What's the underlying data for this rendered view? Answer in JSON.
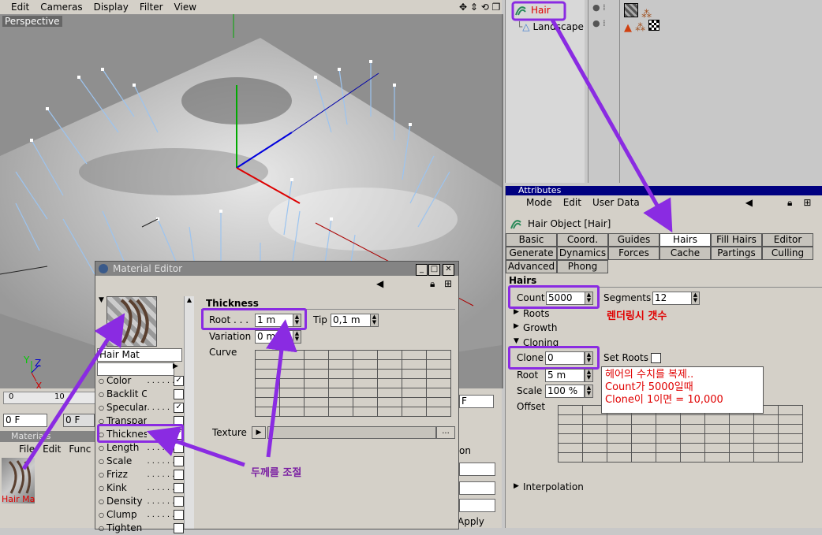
{
  "viewport_menu": {
    "edit": "Edit",
    "cameras": "Cameras",
    "display": "Display",
    "filter": "Filter",
    "view": "View"
  },
  "viewport": {
    "label": "Perspective"
  },
  "objects": [
    {
      "name": "Hair",
      "color": "#e00000"
    },
    {
      "name": "Landscape",
      "color": "#000000"
    }
  ],
  "attributes": {
    "title": "Attributes",
    "menu": {
      "mode": "Mode",
      "edit": "Edit",
      "user_data": "User Data"
    },
    "object_title": "Hair Object [Hair]",
    "tabs": [
      "Basic",
      "Coord.",
      "Guides",
      "Hairs",
      "Fill Hairs",
      "Editor",
      "Generate",
      "Dynamics",
      "Forces",
      "Cache",
      "Partings",
      "Culling",
      "Advanced",
      "Phong"
    ],
    "active_tab": "Hairs",
    "section": "Hairs",
    "count_label": "Count",
    "count_value": "5000",
    "segments_label": "Segments",
    "segments_value": "12",
    "roots_group": "Roots",
    "growth_group": "Growth",
    "cloning_group": "Cloning",
    "clone_label": "Clone",
    "clone_value": "0",
    "set_roots_label": "Set Roots",
    "root_label": "Root",
    "root_value": "5 m",
    "scale_label": "Scale",
    "scale_value": "100 %",
    "offset_label": "Offset",
    "interpolation_group": "Interpolation"
  },
  "annotations": {
    "count_note": "렌더링시 갯수",
    "clone_note_1": "헤어의 수치를 복제..",
    "clone_note_2": "Count가 5000일때",
    "clone_note_3": "Clone이 1이면 = 10,000",
    "thickness_note": "두께를 조절"
  },
  "material_editor": {
    "title": "Material Editor",
    "material_name": "Hair Mat",
    "channels": [
      {
        "label": "Color",
        "dots": " . . . . . . . .",
        "checked": true
      },
      {
        "label": "Backlit Color",
        "dots": "",
        "checked": false
      },
      {
        "label": "Specular",
        "dots": " . . . . .",
        "checked": true
      },
      {
        "label": "Transparency",
        "dots": "",
        "checked": false
      },
      {
        "label": "Thickness",
        "dots": "",
        "checked": true
      },
      {
        "label": "Length",
        "dots": " . . . . . . .",
        "checked": false
      },
      {
        "label": "Scale",
        "dots": " . . . . . . . .",
        "checked": false
      },
      {
        "label": "Frizz",
        "dots": " . . . . . . . .",
        "checked": false
      },
      {
        "label": "Kink",
        "dots": " . . . . . . . .",
        "checked": false
      },
      {
        "label": "Density",
        "dots": " . . . . . .",
        "checked": false
      },
      {
        "label": "Clump",
        "dots": " . . . . . . .",
        "checked": false
      },
      {
        "label": "Tighten",
        "dots": "",
        "checked": false
      }
    ],
    "section": "Thickness",
    "root_label": "Root . . .",
    "root_value": "1 m",
    "tip_label": "Tip",
    "tip_value": "0,1 m",
    "variation_label": "Variation",
    "variation_value": "0 m",
    "curve_label": "Curve",
    "texture_label": "Texture",
    "texture_button": "..."
  },
  "timeline": {
    "frame_a": "0 F",
    "frame_b": "0 F",
    "tick_0": "0",
    "tick_10": "10",
    "frame_end": "F"
  },
  "material_manager": {
    "title": "Materials",
    "menu_file": "File",
    "menu_edit": "Edit",
    "menu_func": "Func",
    "material": "Hair Ma"
  },
  "lower_panel": {
    "partial_label": "on",
    "apply": "Apply"
  },
  "colors": {
    "accent": "#8a2be2",
    "highlight_red": "#e00000",
    "titlebar": "#000080"
  }
}
